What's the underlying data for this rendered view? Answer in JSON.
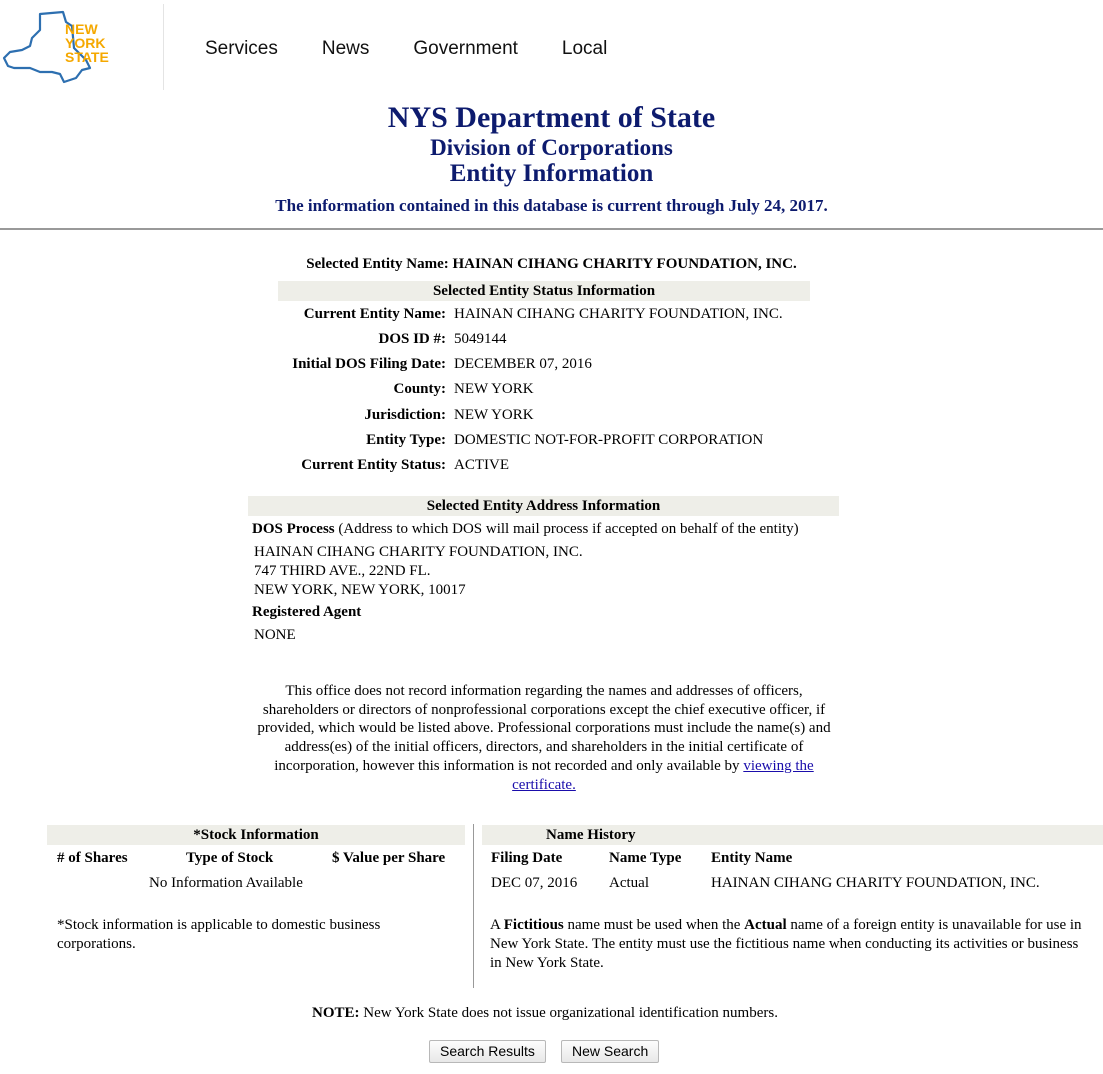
{
  "logo": {
    "text_line1": "NEW",
    "text_line2": "YORK",
    "text_line3": "STATE",
    "outline_color": "#2d6fb0",
    "text_color": "#f5a800"
  },
  "nav": [
    "Services",
    "News",
    "Government",
    "Local"
  ],
  "header": {
    "title": "NYS Department of State",
    "division": "Division of Corporations",
    "section": "Entity Information",
    "currency_note": "The information contained in this database is current through July 24, 2017.",
    "color": "#0d1b6e"
  },
  "selected_entity_name_label": "Selected Entity Name:",
  "selected_entity_name": "HAINAN CIHANG CHARITY FOUNDATION, INC.",
  "status_section": {
    "heading": "Selected Entity Status Information",
    "rows": [
      {
        "label": "Current Entity Name:",
        "value": "HAINAN CIHANG CHARITY FOUNDATION, INC."
      },
      {
        "label": "DOS ID #:",
        "value": "5049144"
      },
      {
        "label": "Initial DOS Filing Date:",
        "value": "DECEMBER 07, 2016"
      },
      {
        "label": "County:",
        "value": "NEW YORK"
      },
      {
        "label": "Jurisdiction:",
        "value": "NEW YORK"
      },
      {
        "label": "Entity Type:",
        "value": "DOMESTIC NOT-FOR-PROFIT CORPORATION"
      },
      {
        "label": "Current Entity Status:",
        "value": "ACTIVE"
      }
    ]
  },
  "address_section": {
    "heading": "Selected Entity Address Information",
    "dos_process_label": "DOS Process",
    "dos_process_desc": " (Address to which DOS will mail process if accepted on behalf of the entity)",
    "address_lines": [
      "HAINAN CIHANG CHARITY FOUNDATION, INC.",
      "747 THIRD AVE., 22ND FL.",
      "NEW YORK, NEW YORK, 10017"
    ],
    "registered_agent_label": "Registered Agent",
    "registered_agent_value": "NONE"
  },
  "notice": {
    "text": "This office does not record information regarding the names and addresses of officers, shareholders or directors of nonprofessional corporations except the chief executive officer, if provided, which would be listed above. Professional corporations must include the name(s) and address(es) of the initial officers, directors, and shareholders in the initial certificate of incorporation, however this information is not recorded and only available by",
    "link": "viewing the certificate."
  },
  "stock": {
    "heading": "*Stock Information",
    "columns": [
      "# of Shares",
      "Type of Stock",
      "$ Value per Share"
    ],
    "empty": "No Information Available",
    "footnote_line1": "*Stock information is applicable to domestic business",
    "footnote_line2": "corporations."
  },
  "name_history": {
    "heading": "Name History",
    "columns": [
      "Filing Date",
      "Name Type",
      "Entity Name"
    ],
    "rows": [
      {
        "date": "DEC 07, 2016",
        "type": "Actual",
        "name": "HAINAN CIHANG CHARITY FOUNDATION, INC."
      }
    ],
    "fictitious_note": {
      "p1": "A ",
      "b1": "Fictitious",
      "p2": " name must be used when the ",
      "b2": "Actual",
      "p3": " name of a foreign entity is unavailable for use in",
      "line2": "New York State. The entity must use the fictitious name when conducting its activities or business",
      "line3": "in New York State."
    }
  },
  "note": {
    "label": "NOTE:",
    "text": " New York State does not issue organizational identification numbers."
  },
  "buttons": {
    "search_results": "Search Results",
    "new_search": "New Search"
  }
}
